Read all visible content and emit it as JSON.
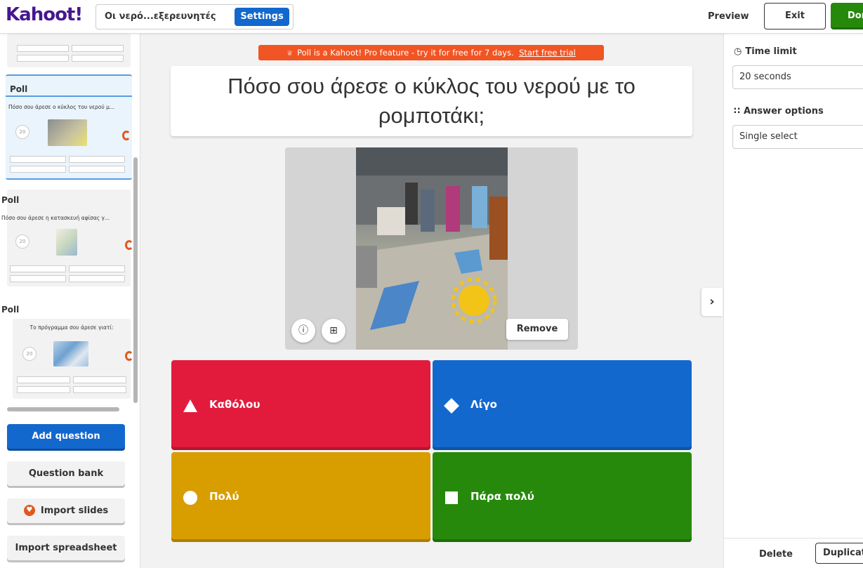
{
  "header": {
    "logo": "Kahoot!",
    "kahoot_title": "Οι νερό...εξερευνητές",
    "settings_label": "Settings",
    "preview_label": "Preview",
    "exit_label": "Exit",
    "done_label": "Done"
  },
  "sidebar": {
    "slides": [
      {
        "type": "Poll",
        "question": "Πόσο σου άρεσε ο κύκλος του νερού μ...",
        "time": "20"
      },
      {
        "type": "Poll",
        "question": "Πόσο σου άρεσε η κατασκευή αφίσας γ...",
        "time": "20"
      },
      {
        "type": "Poll",
        "question": "Το πρόγραμμα σου άρεσε γιατί:",
        "time": "20"
      }
    ],
    "add_question": "Add question",
    "question_bank": "Question bank",
    "import_slides": "Import slides",
    "import_spreadsheet": "Import spreadsheet"
  },
  "main": {
    "promo_text": "Poll is a Kahoot! Pro feature - try it for free for 7 days.",
    "promo_link": "Start free trial",
    "question": "Πόσο σου άρεσε ο κύκλος του νερού με το ρομποτάκι;",
    "remove_label": "Remove",
    "answers": [
      {
        "text": "Καθόλου",
        "shape": "triangle",
        "color": "#e21b3c"
      },
      {
        "text": "Λίγο",
        "shape": "diamond",
        "color": "#1368ce"
      },
      {
        "text": "Πολύ",
        "shape": "circle",
        "color": "#d89e00"
      },
      {
        "text": "Πάρα πολύ",
        "shape": "square",
        "color": "#26890c"
      }
    ]
  },
  "right_panel": {
    "time_limit_label": "Time limit",
    "time_limit_value": "20 seconds",
    "answer_options_label": "Answer options",
    "answer_options_value": "Single select",
    "delete_label": "Delete",
    "duplicate_label": "Duplicate"
  }
}
